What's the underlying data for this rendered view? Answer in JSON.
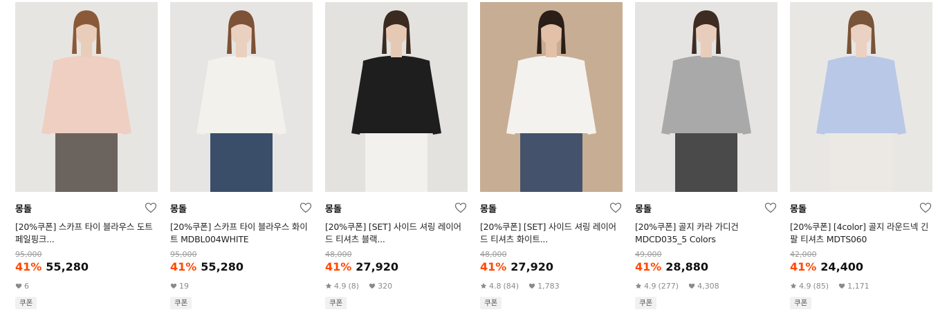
{
  "products": [
    {
      "brand": "몽돌",
      "title": "[20%쿠폰] 스카프 타이 블라우스 도트페일핑크...",
      "original_price": "95,000",
      "discount": "41%",
      "price": "55,280",
      "rating": "",
      "review_count": "",
      "likes": "6",
      "badge": "쿠폰",
      "image_colors": {
        "bg": "#e7e5e2",
        "top": "#efcfc2",
        "bottom": "#6b645e",
        "skin": "#e9cdbb",
        "hair": "#8a5a38"
      }
    },
    {
      "brand": "몽돌",
      "title": "[20%쿠폰] 스카프 타이 블라우스 화이트 MDBL004WHITE",
      "original_price": "95,000",
      "discount": "41%",
      "price": "55,280",
      "rating": "",
      "review_count": "",
      "likes": "19",
      "badge": "쿠폰",
      "image_colors": {
        "bg": "#e6e5e3",
        "top": "#f3f1ec",
        "bottom": "#3a4e6a",
        "skin": "#ead0bf",
        "hair": "#7e5236"
      }
    },
    {
      "brand": "몽돌",
      "title": "[20%쿠폰] [SET] 사이드 셔링 레이어드 티셔츠 블랙...",
      "original_price": "48,000",
      "discount": "41%",
      "price": "27,920",
      "rating": "4.9",
      "review_count": "(8)",
      "likes": "320",
      "badge": "쿠폰",
      "image_colors": {
        "bg": "#e3e2df",
        "top": "#1e1e1e",
        "bottom": "#f2f1ee",
        "skin": "#e6c9b5",
        "hair": "#3a2a20"
      }
    },
    {
      "brand": "몽돌",
      "title": "[20%쿠폰] [SET] 사이드 셔링 레이어드 티셔츠 화이트...",
      "original_price": "48,000",
      "discount": "41%",
      "price": "27,920",
      "rating": "4.8",
      "review_count": "(84)",
      "likes": "1,783",
      "badge": "쿠폰",
      "image_colors": {
        "bg": "#c7ad93",
        "top": "#f4f2ee",
        "bottom": "#44536b",
        "skin": "#e2c1a8",
        "hair": "#2a1e18"
      }
    },
    {
      "brand": "몽돌",
      "title": "[20%쿠폰] 골지 카라 가디건 MDCD035_5 Colors",
      "original_price": "49,000",
      "discount": "41%",
      "price": "28,880",
      "rating": "4.9",
      "review_count": "(277)",
      "likes": "4,308",
      "badge": "쿠폰",
      "image_colors": {
        "bg": "#e5e4e2",
        "top": "#a9a9a9",
        "bottom": "#4a4a4a",
        "skin": "#e8cdbc",
        "hair": "#3e2c22"
      }
    },
    {
      "brand": "몽돌",
      "title": "[20%쿠폰] [4color] 골지 라운드넥 긴팔 티셔츠 MDTS060",
      "original_price": "42,000",
      "discount": "41%",
      "price": "24,400",
      "rating": "4.9",
      "review_count": "(85)",
      "likes": "1,171",
      "badge": "쿠폰",
      "image_colors": {
        "bg": "#e8e7e4",
        "top": "#b9c8e6",
        "bottom": "#ece9e4",
        "skin": "#ead1c2",
        "hair": "#7a5438"
      }
    }
  ],
  "accent_color": "#ff4800"
}
